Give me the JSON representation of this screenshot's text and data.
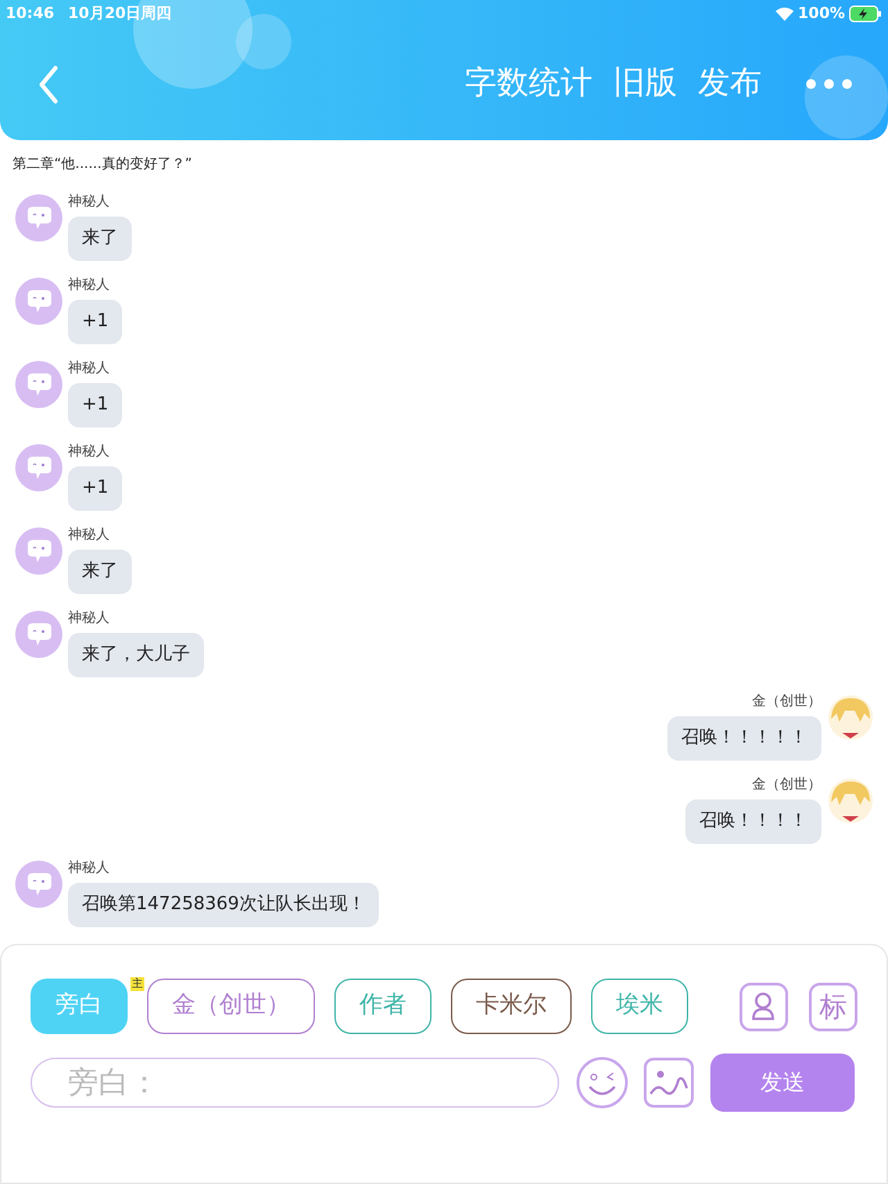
{
  "status_bar": {
    "time": "10:46",
    "date": "10月20日周四",
    "battery": "100%"
  },
  "header": {
    "actions": [
      "字数统计",
      "旧版",
      "发布"
    ]
  },
  "chapter_title": "第二章“他......真的变好了？”",
  "messages": [
    {
      "kind": "incoming",
      "name": "神秘人",
      "text": "来了"
    },
    {
      "kind": "incoming",
      "name": "神秘人",
      "text": "+1"
    },
    {
      "kind": "incoming",
      "name": "神秘人",
      "text": "+1"
    },
    {
      "kind": "incoming",
      "name": "神秘人",
      "text": "+1"
    },
    {
      "kind": "incoming",
      "name": "神秘人",
      "text": "来了"
    },
    {
      "kind": "incoming",
      "name": "神秘人",
      "text": "来了，大儿子"
    },
    {
      "kind": "outgoing",
      "name": "金（创世）",
      "text": "召唤！！！！！"
    },
    {
      "kind": "outgoing",
      "name": "金（创世）",
      "text": "召唤！！！！"
    },
    {
      "kind": "incoming",
      "name": "神秘人",
      "text": "召唤第147258369次让队长出现！"
    }
  ],
  "roles": [
    {
      "label": "旁白",
      "selected": true,
      "color": "#4fd3f5"
    },
    {
      "label": "金（创世）",
      "selected": false,
      "color": "#b07fd0",
      "badge": "主"
    },
    {
      "label": "作者",
      "selected": false,
      "color": "#3fb5a8"
    },
    {
      "label": "卡米尔",
      "selected": false,
      "color": "#7a5a4a"
    },
    {
      "label": "埃米",
      "selected": false,
      "color": "#3fb5a8"
    }
  ],
  "tag_button": "标",
  "input": {
    "placeholder": "旁白："
  },
  "send_button": "发送"
}
